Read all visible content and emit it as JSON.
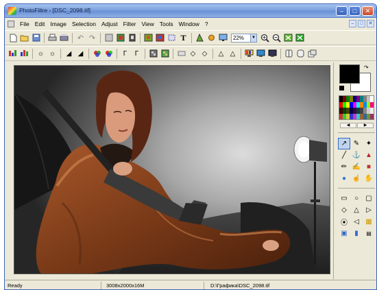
{
  "window": {
    "title": "PhotoFiltre - [DSC_2098.tif]",
    "minimize_icon": "minimize-icon",
    "maximize_icon": "maximize-icon",
    "close_icon": "close-icon"
  },
  "menubar": {
    "items": [
      "File",
      "Edit",
      "Image",
      "Selection",
      "Adjust",
      "Filter",
      "View",
      "Tools",
      "Window",
      "?"
    ]
  },
  "toolbar": {
    "zoom_value": "22%"
  },
  "colors": {
    "foreground": "#000000",
    "background": "#ffffff",
    "accent": "#316ac5"
  },
  "statusbar": {
    "status": "Ready",
    "dimensions": "3008x2000x16M",
    "file_path": "D:\\Графика\\DSC_2098.tif"
  }
}
